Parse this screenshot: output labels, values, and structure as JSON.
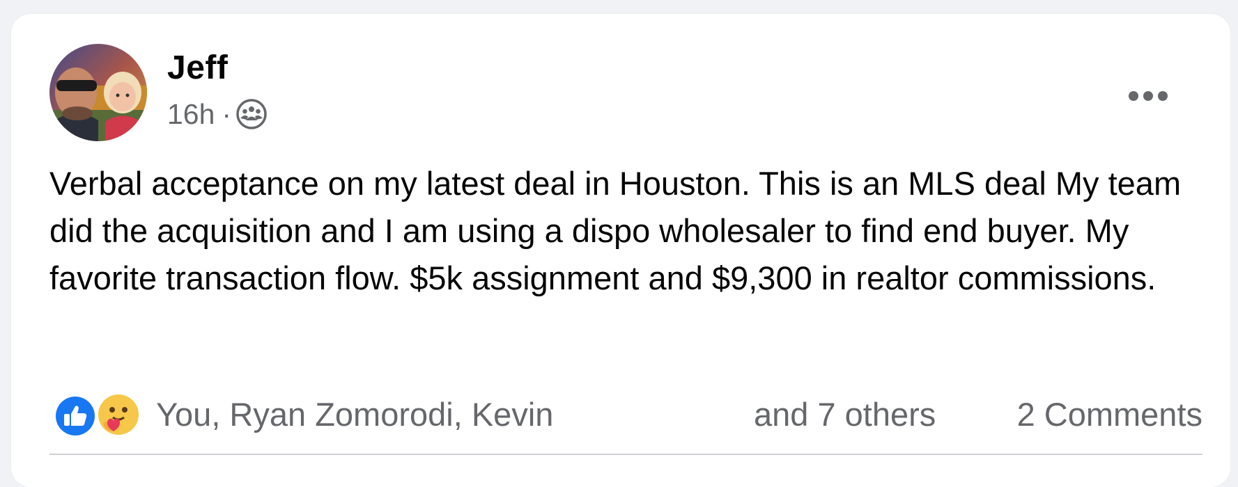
{
  "post": {
    "author": "Jeff",
    "time": "16h",
    "separator": "·",
    "audience_icon": "group-audience-icon",
    "more_icon": "more-options-icon",
    "text": "Verbal acceptance on my latest deal in Houston. This is an MLS deal My team did the acquisition and I am using a dispo wholesaler to find end buyer. My favorite transaction flow. $5k assignment and $9,300 in realtor commissions."
  },
  "reactions": {
    "icons": [
      "like-icon",
      "care-icon"
    ],
    "reactors": "You, Ryan Zomorodi, Kevin",
    "others": "and 7 others",
    "comments": "2 Comments"
  },
  "colors": {
    "background": "#f0f2f5",
    "card": "#ffffff",
    "text": "#050505",
    "secondary_text": "#65676b",
    "like_blue": "#1877f2",
    "divider": "#ced0d4"
  }
}
